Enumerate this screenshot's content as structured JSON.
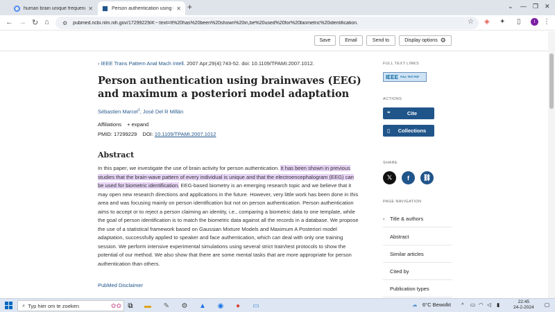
{
  "browser": {
    "tabs": [
      {
        "title": "human brain unique frequency",
        "active": false
      },
      {
        "title": "Person authentication using brainwaves",
        "active": true
      }
    ],
    "url": "pubmed.ncbi.nlm.nih.gov/17299229/#:~:text=It%20has%20been%20shown%20in,be%20used%20for%20biometric%20identification."
  },
  "actions_bar": {
    "save": "Save",
    "email": "Email",
    "send_to": "Send to",
    "display_options": "Display options"
  },
  "article": {
    "journal": "IEEE Trans Pattern Anal Mach Intell",
    "citation": ". 2007 Apr;29(4):743-52. doi: 10.1109/TPAMI.2007.1012.",
    "title": "Person authentication using brainwaves (EEG) and maximum a posteriori model adaptation",
    "authors": [
      {
        "name": "Sébastien Marcel",
        "sup": "1"
      },
      {
        "name": "José Del R Millán",
        "sup": ""
      }
    ],
    "affiliations_label": "Affiliations",
    "expand_label": "expand",
    "pmid_label": "PMID:",
    "pmid": "17299229",
    "doi_label": "DOI:",
    "doi": "10.1109/TPAMI.2007.1012",
    "abstract_heading": "Abstract",
    "abstract_before": "In this paper, we investigate the use of brain activity for person authentication. ",
    "abstract_highlight": "It has been shown in previous studies that the brain-wave pattern of every individual is unique and that the electroencephalogram (EEG) can be used for biometric identification.",
    "abstract_after": " EEG-based biometry is an emerging research topic and we believe that it may open new research directions and applications in the future. However, very little work has been done in this area and was focusing mainly on person identification but not on person authentication. Person authentication aims to accept or to reject a person claiming an identity, i.e., comparing a biometric data to one template, while the goal of person identification is to match the biometric data against all the records in a database. We propose the use of a statistical framework based on Gaussian Mixture Models and Maximum A Posteriori model adaptation, successfully applied to speaker and face authentication, which can deal with only one training session. We perform intensive experimental simulations using several strict train/test protocols to show the potential of our method. We also show that there are some mental tasks that are more appropriate for person authentication than others.",
    "disclaimer": "PubMed Disclaimer"
  },
  "sidebar": {
    "full_text_links": "FULL TEXT LINKS",
    "ieee_logo": "IEEE",
    "ieee_sub": "FULL TEXT PDF",
    "actions_heading": "ACTIONS",
    "cite": "Cite",
    "collections": "Collections",
    "share_heading": "SHARE",
    "page_nav_heading": "PAGE NAVIGATION",
    "nav_items": [
      "Title & authors",
      "Abstract",
      "Similar articles",
      "Cited by",
      "Publication types"
    ]
  },
  "taskbar": {
    "search_placeholder": "Typ hier om te zoeken",
    "weather": "6°C  Bewolkt",
    "time": "22:45",
    "date": "24-2-2024"
  }
}
